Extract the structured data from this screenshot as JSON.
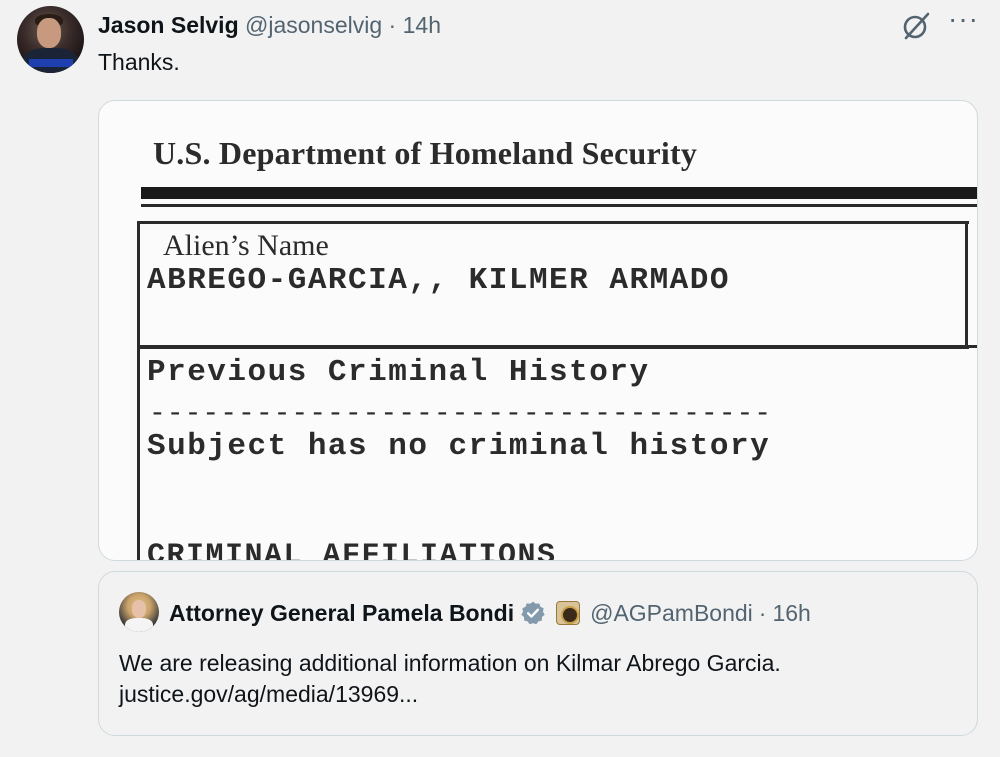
{
  "tweet": {
    "author_name": "Jason Selvig",
    "author_handle": "@jasonselvig",
    "separator": "·",
    "time": "14h",
    "text": "Thanks.",
    "menu_label": "···"
  },
  "media": {
    "title": "U.S. Department of Homeland Security",
    "label_alien_name": "Alien’s Name",
    "alien_name": "ABREGO-GARCIA,, KILMER ARMADO",
    "section_heading": "Previous Criminal History",
    "dash_line": "-----------------------------------",
    "section_text": "Subject has no criminal history",
    "cut_heading": "CRIMINAL AFFILIATIONS"
  },
  "quoted_tweet": {
    "author_name": "Attorney General Pamela Bondi",
    "author_handle": "@AGPamBondi",
    "separator": "·",
    "time": "16h",
    "text_line1": "We are releasing additional information on Kilmar Abrego Garcia.",
    "text_line2": "justice.gov/ag/media/13969..."
  },
  "icons": {
    "verified_color": "#829aab",
    "grok": "grok-icon",
    "more": "more-icon"
  }
}
